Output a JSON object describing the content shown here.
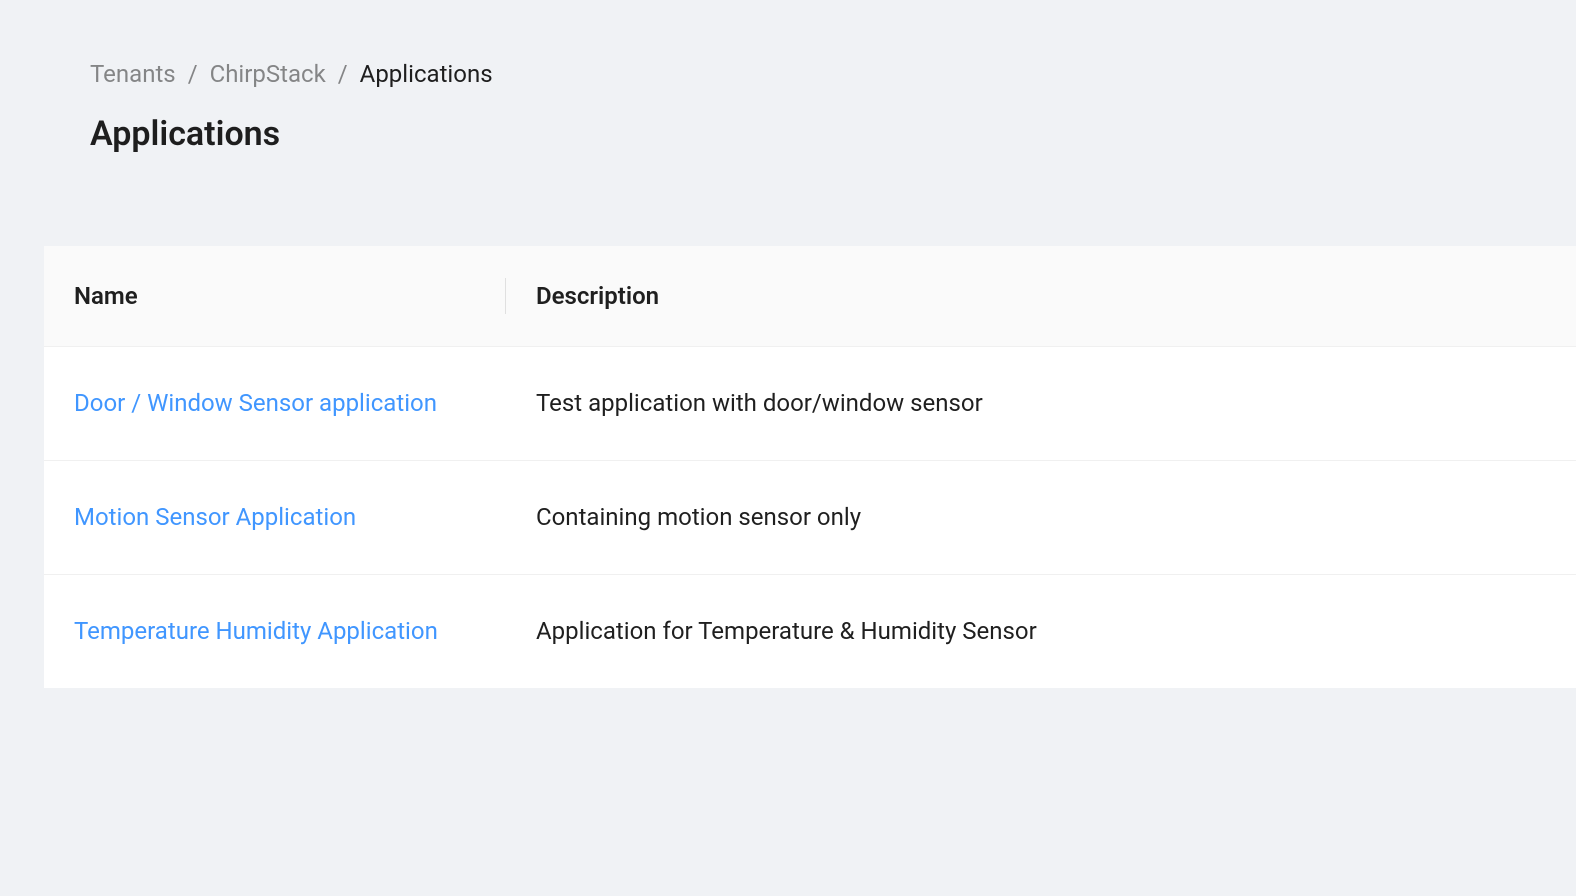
{
  "breadcrumb": {
    "items": [
      {
        "label": "Tenants",
        "link": true
      },
      {
        "label": "ChirpStack",
        "link": true
      },
      {
        "label": "Applications",
        "link": false
      }
    ],
    "separator": "/"
  },
  "title": "Applications",
  "table": {
    "columns": [
      {
        "label": "Name"
      },
      {
        "label": "Description"
      }
    ],
    "rows": [
      {
        "name": "Door / Window Sensor application",
        "description": "Test application with door/window sensor"
      },
      {
        "name": "Motion Sensor Application",
        "description": "Containing motion sensor only"
      },
      {
        "name": "Temperature Humidity Application",
        "description": "Application for Temperature & Humidity Sensor"
      }
    ]
  }
}
